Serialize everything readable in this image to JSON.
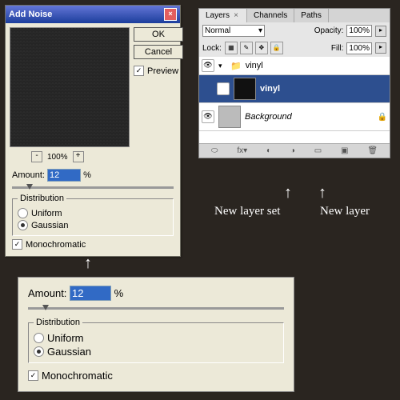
{
  "noise": {
    "title": "Add Noise",
    "ok": "OK",
    "cancel": "Cancel",
    "preview_label": "Preview",
    "zoom": "100%",
    "amount_label": "Amount:",
    "amount_value": "12",
    "amount_unit": "%",
    "dist_label": "Distribution",
    "uniform": "Uniform",
    "gaussian": "Gaussian",
    "mono": "Monochromatic"
  },
  "layers": {
    "tabs": [
      "Layers",
      "Channels",
      "Paths"
    ],
    "blend": "Normal",
    "opacity_label": "Opacity:",
    "opacity": "100%",
    "lock_label": "Lock:",
    "fill_label": "Fill:",
    "fill": "100%",
    "set_name": "vinyl",
    "layer1": "vinyl",
    "bg": "Background"
  },
  "annot": {
    "new_set": "New layer set",
    "new_layer": "New layer"
  }
}
